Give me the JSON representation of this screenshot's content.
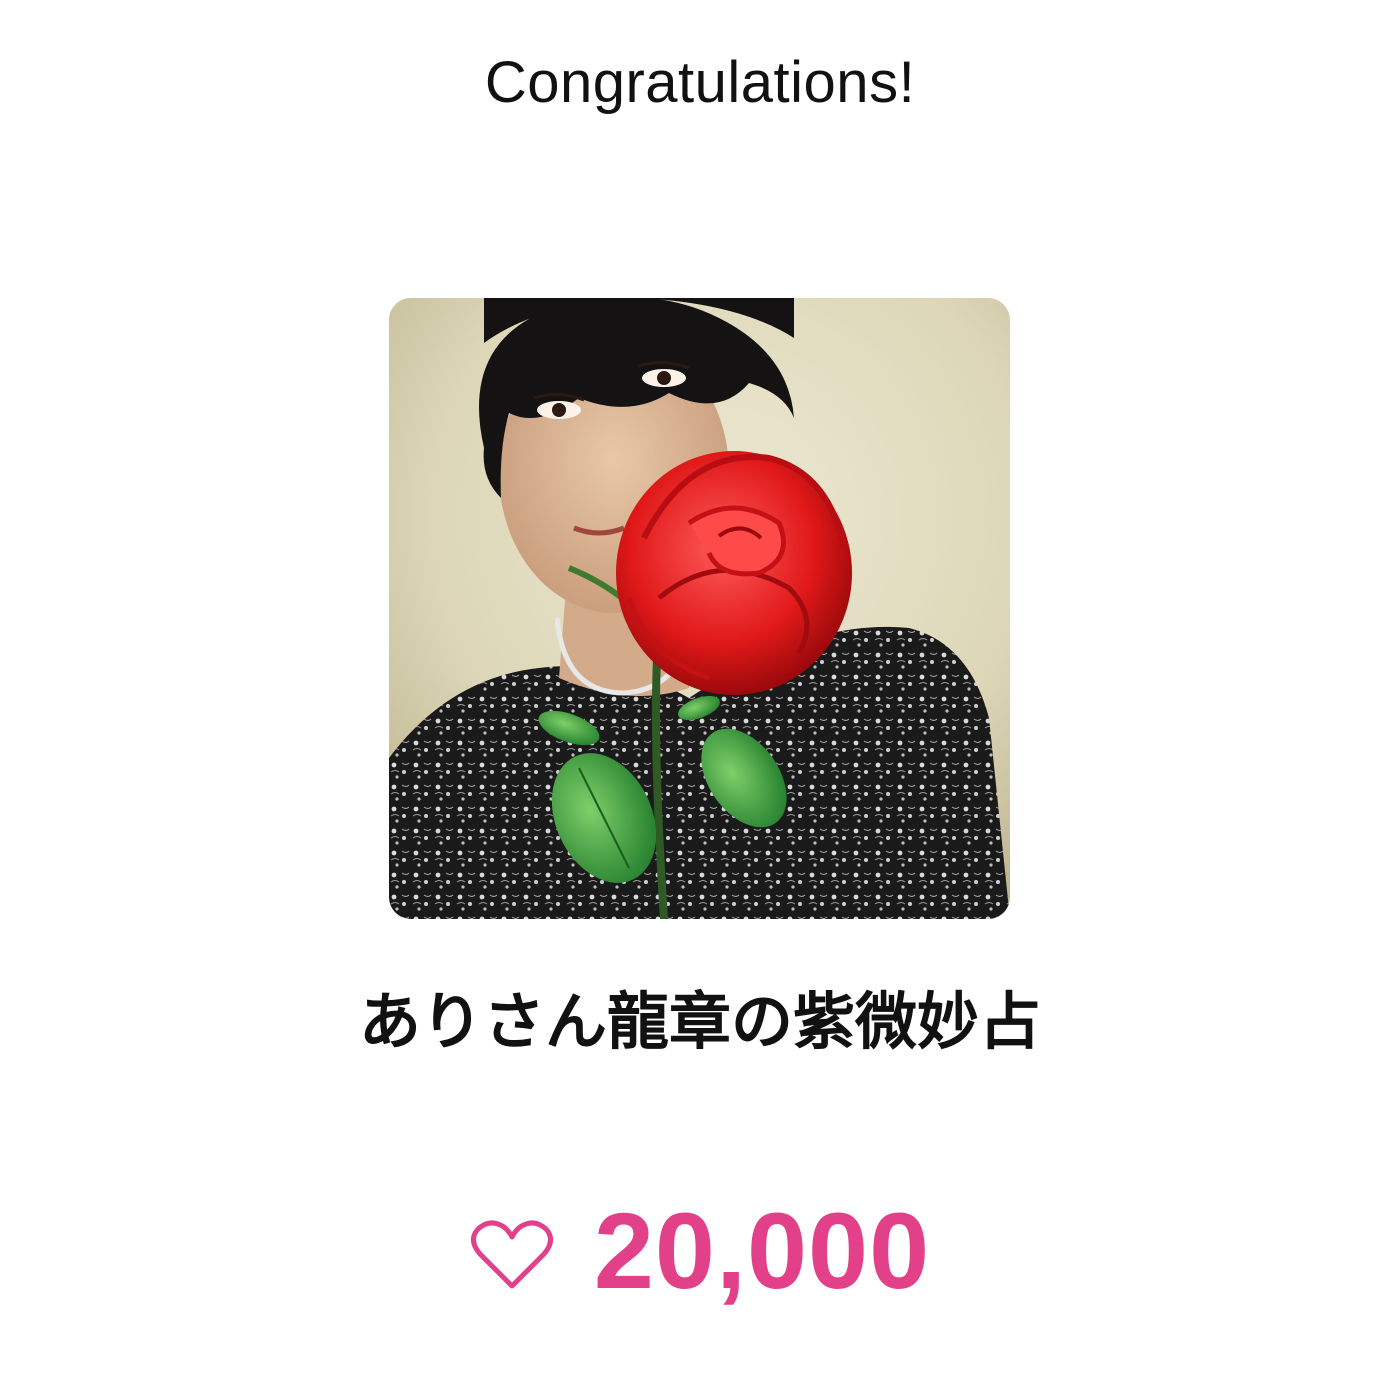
{
  "header": {
    "title": "Congratulations!"
  },
  "profile": {
    "photo_icon": "profile-photo-woman-with-red-rose",
    "name": "ありさん龍章の紫微妙占"
  },
  "likes": {
    "icon": "heart-outline-icon",
    "count": "20,000",
    "color": "#e2418a"
  }
}
